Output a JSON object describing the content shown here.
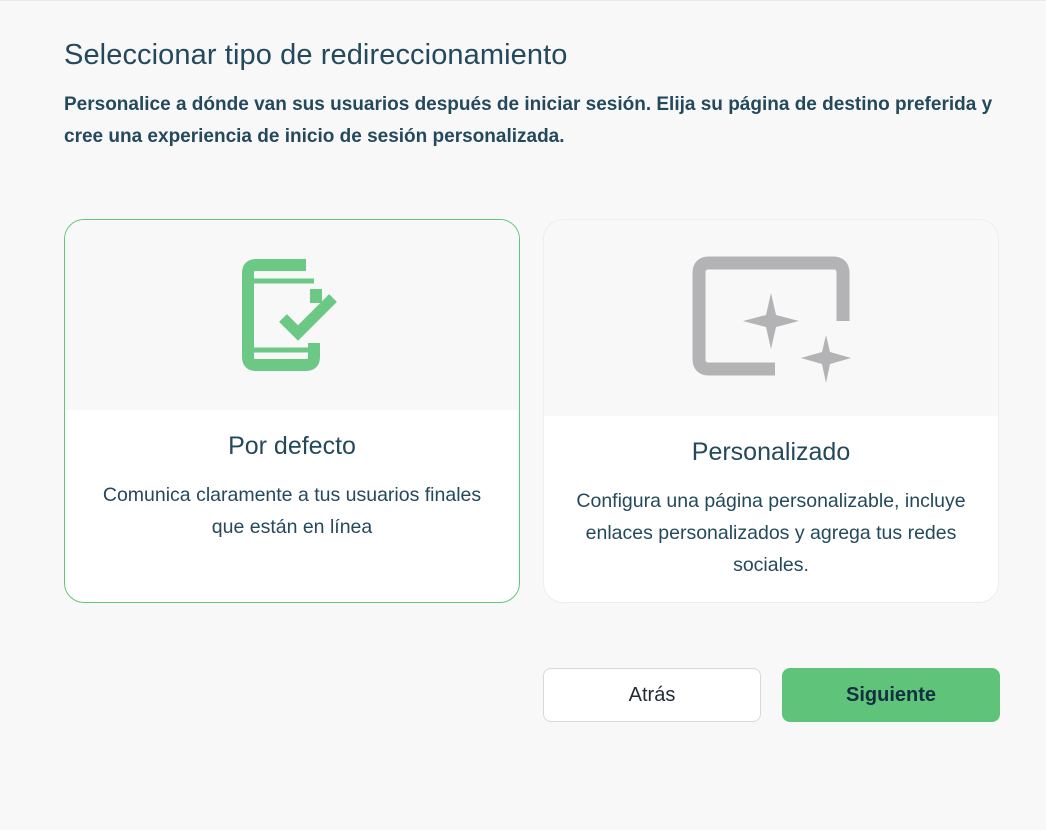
{
  "header": {
    "title": "Seleccionar tipo de redireccionamiento",
    "subtitle": "Personalice a dónde van sus usuarios después de iniciar sesión. Elija su página de destino preferida y cree una experiencia de inicio de sesión personalizada."
  },
  "options": [
    {
      "title": "Por defecto",
      "description": "Comunica claramente a tus usuarios finales que están en línea",
      "icon": "phone-check-icon",
      "selected": true,
      "accent_color": "#63c47a"
    },
    {
      "title": "Personalizado",
      "description": "Configura una página personalizable, incluye enlaces personalizados y agrega tus redes sociales.",
      "icon": "sparkle-frame-icon",
      "selected": false,
      "accent_color": "#b3b3b6"
    }
  ],
  "actions": {
    "back_label": "Atrás",
    "next_label": "Siguiente",
    "next_color": "#5fc37a"
  }
}
